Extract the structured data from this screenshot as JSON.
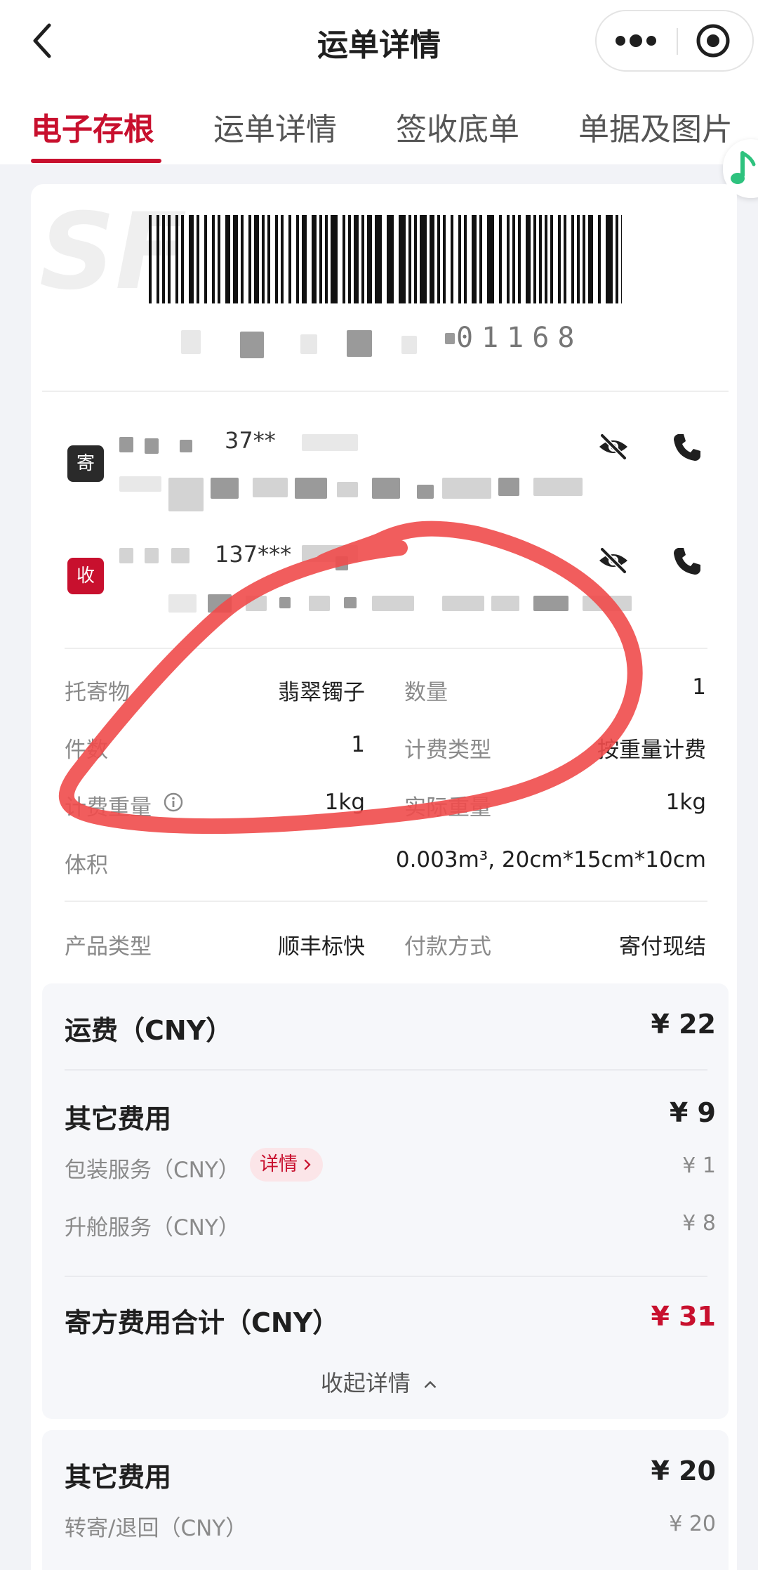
{
  "header": {
    "title": "运单详情"
  },
  "tabs": [
    {
      "label": "电子存根",
      "active": true
    },
    {
      "label": "运单详情",
      "active": false
    },
    {
      "label": "签收底单",
      "active": false
    },
    {
      "label": "单据及图片",
      "active": false
    }
  ],
  "waybill": {
    "number_visible": "01168"
  },
  "sender": {
    "badge": "寄",
    "phone": "37**"
  },
  "receiver": {
    "badge": "收",
    "phone": "137***"
  },
  "details": {
    "item_label": "托寄物",
    "item_value": "翡翠镯子",
    "qty_label": "数量",
    "qty_value": "1",
    "pieces_label": "件数",
    "pieces_value": "1",
    "billing_label": "计费类型",
    "billing_value": "按重量计费",
    "charged_weight_label": "计费重量",
    "charged_weight_value": "1kg",
    "actual_weight_label": "实际重量",
    "actual_weight_value": "1kg",
    "volume_label": "体积",
    "volume_value": "0.003m³, 20cm*15cm*10cm",
    "product_label": "产品类型",
    "product_value": "顺丰标快",
    "payment_label": "付款方式",
    "payment_value": "寄付现结"
  },
  "fees": {
    "freight_label": "运费（CNY）",
    "freight_value": "¥ 22",
    "other_label": "其它费用",
    "other_value": "¥ 9",
    "packaging_label": "包装服务（CNY）",
    "packaging_value": "¥ 1",
    "detail_chip": "详情",
    "cabin_label": "升舱服务（CNY）",
    "cabin_value": "¥ 8",
    "total_label": "寄方费用合计（CNY）",
    "total_value": "¥ 31",
    "collapse_label": "收起详情"
  },
  "other_fees_2": {
    "label": "其它费用",
    "value": "¥ 20",
    "forward_label": "转寄/退回（CNY）",
    "forward_value": "¥ 20"
  },
  "colors": {
    "brand_red": "#c8102e",
    "scribble": "#ef4b4b"
  },
  "icons": [
    "back-arrow-icon",
    "more-icon",
    "target-icon",
    "music-note-icon",
    "eye-off-icon",
    "phone-icon",
    "info-icon",
    "chevron-right-icon",
    "chevron-up-icon",
    "sf-logo-icon"
  ]
}
